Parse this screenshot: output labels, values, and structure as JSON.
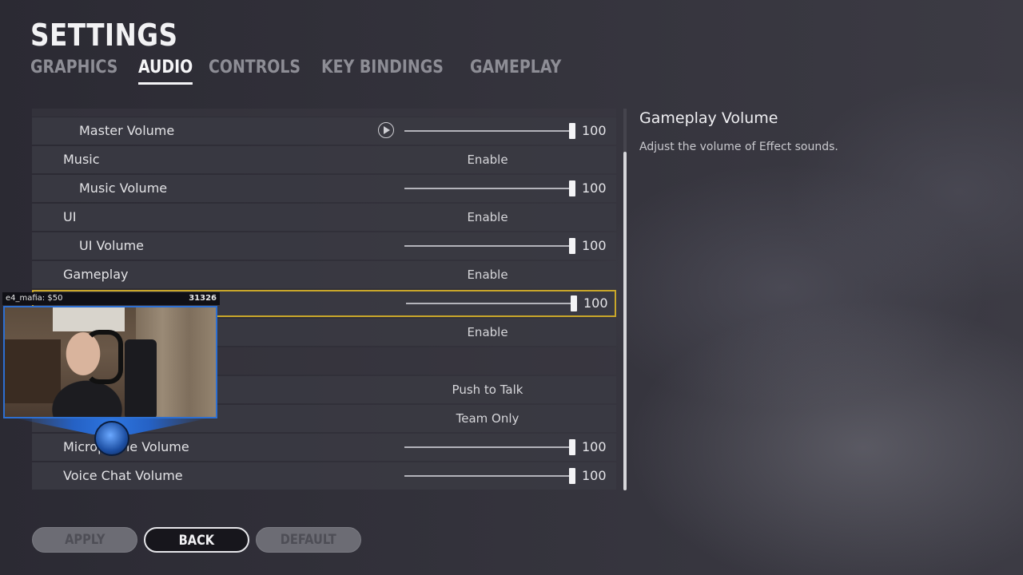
{
  "header": {
    "title": "SETTINGS"
  },
  "tabs": [
    {
      "label": "GRAPHICS",
      "active": false
    },
    {
      "label": "AUDIO",
      "active": true
    },
    {
      "label": "CONTROLS",
      "active": false
    },
    {
      "label": "KEY BINDINGS",
      "active": false
    },
    {
      "label": "GAMEPLAY",
      "active": false
    }
  ],
  "rows": {
    "master_volume": {
      "label": "Master Volume",
      "value": "100",
      "level": 1.0
    },
    "music": {
      "label": "Music",
      "value": "Enable"
    },
    "music_volume": {
      "label": "Music Volume",
      "value": "100",
      "level": 1.0
    },
    "ui": {
      "label": "UI",
      "value": "Enable"
    },
    "ui_volume": {
      "label": "UI Volume",
      "value": "100",
      "level": 1.0
    },
    "gameplay": {
      "label": "Gameplay",
      "value": "Enable"
    },
    "gameplay_volume": {
      "value": "100",
      "level": 1.0
    },
    "row_enable": {
      "value": "Enable"
    },
    "voice_mode": {
      "value": "Push to Talk"
    },
    "voice_channel": {
      "value": "Team Only"
    },
    "microphone_volume": {
      "label": "Microphone Volume",
      "value": "100",
      "level": 1.0
    },
    "voice_chat_volume": {
      "label": "Voice Chat Volume",
      "value": "100",
      "level": 1.0
    }
  },
  "description": {
    "title": "Gameplay Volume",
    "text": "Adjust the volume of Effect sounds."
  },
  "buttons": {
    "apply": "APPLY",
    "back": "BACK",
    "default": "DEFAULT"
  },
  "stream_overlay": {
    "donation": "e4_mafia: $50",
    "count": "31326"
  },
  "colors": {
    "selection": "#c9a72a",
    "row_bg": "#3a3942",
    "overlay_border": "#2d6fd1"
  }
}
